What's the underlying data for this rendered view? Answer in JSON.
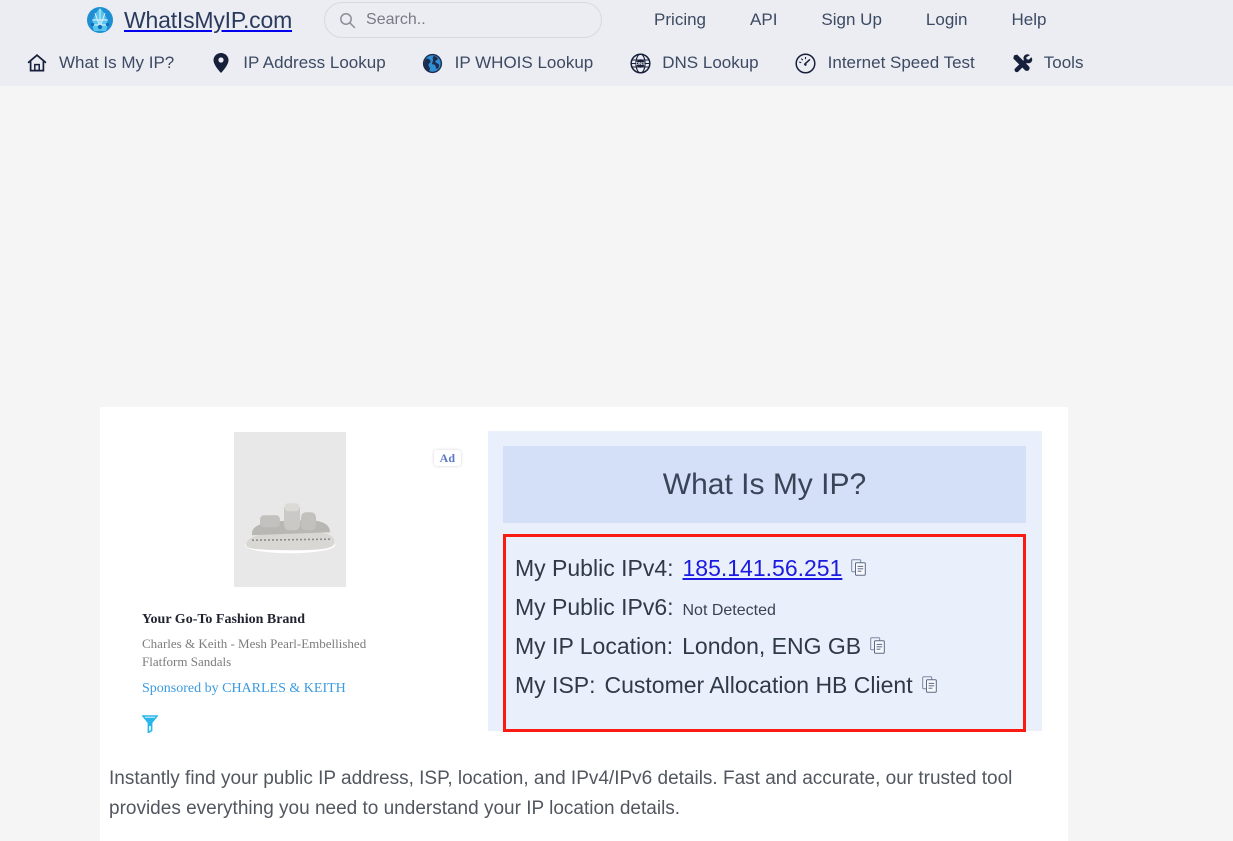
{
  "header": {
    "brand": {
      "name": "WhatIsMyIP.com",
      "logo_icon": "globe-logo-icon"
    },
    "search": {
      "value": "",
      "placeholder": "Search..",
      "icon": "search-icon"
    },
    "top_links": [
      {
        "label": "Pricing"
      },
      {
        "label": "API"
      },
      {
        "label": "Sign Up"
      },
      {
        "label": "Login"
      },
      {
        "label": "Help"
      }
    ],
    "nav_items": [
      {
        "label": "What Is My IP?",
        "icon": "home-icon"
      },
      {
        "label": "IP Address Lookup",
        "icon": "map-pin-icon"
      },
      {
        "label": "IP WHOIS Lookup",
        "icon": "globe-blue-icon"
      },
      {
        "label": "DNS Lookup",
        "icon": "dns-globe-icon"
      },
      {
        "label": "Internet Speed Test",
        "icon": "speedometer-icon"
      },
      {
        "label": "Tools",
        "icon": "tools-icon"
      }
    ]
  },
  "ad": {
    "badge": "Ad",
    "title": "Your Go-To Fashion Brand",
    "description": "Charles & Keith - Mesh Pearl-Embellished Flatform Sandals",
    "sponsor": "Sponsored by CHARLES & KEITH",
    "adchoices_icon": "adchoices-icon",
    "product_image_alt": "grey-sandal-product-image"
  },
  "ip_panel": {
    "title": "What Is My IP?",
    "facts": [
      {
        "label": "My Public IPv4:",
        "value": "185.141.56.251",
        "style": "link",
        "copy": true
      },
      {
        "label": "My Public IPv6:",
        "value": "Not Detected",
        "style": "small",
        "copy": false
      },
      {
        "label": "My IP Location:",
        "value": "London, ENG GB",
        "style": "plain",
        "copy": true
      },
      {
        "label": "My ISP:",
        "value": "Customer Allocation HB Client",
        "style": "plain",
        "copy": true
      }
    ],
    "highlight_color": "#fa1c13",
    "copy_icon": "copy-to-clipboard-icon"
  },
  "description": "Instantly find your public IP address, ISP, location, and IPv4/IPv6 details. Fast and accurate, our trusted tool provides everything you need to understand your IP location details."
}
